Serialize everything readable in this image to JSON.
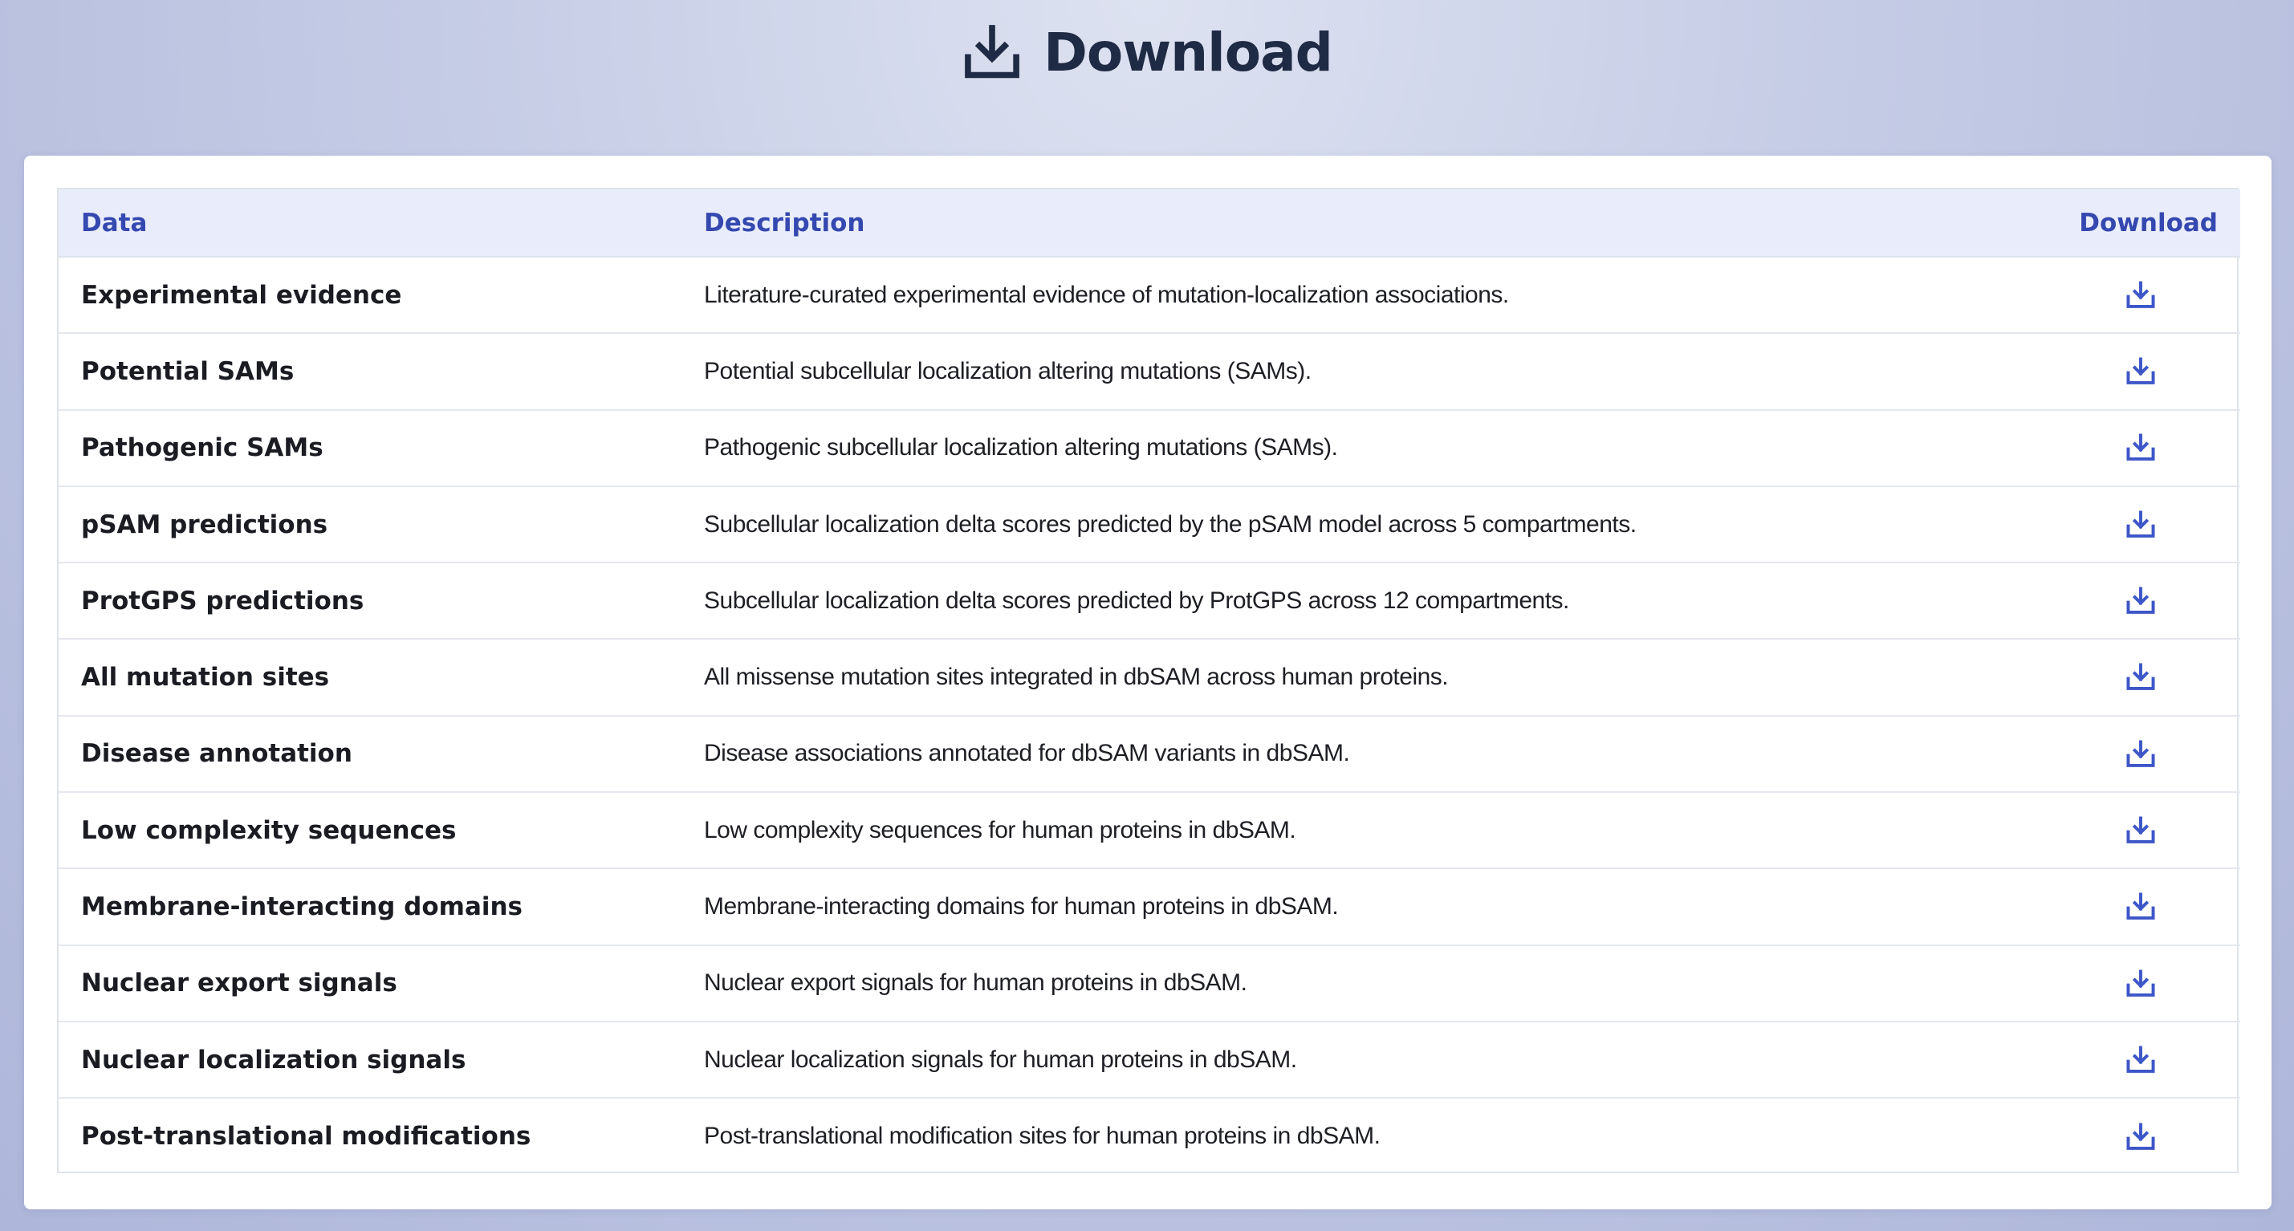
{
  "header": {
    "title": "Download",
    "icon": "download-tray-icon",
    "title_color": "#1f2a44"
  },
  "table": {
    "columns": [
      "Data",
      "Description",
      "Download"
    ],
    "header_text_color": "#3448b0",
    "header_bg": "#e9edfb",
    "download_icon": "download-icon",
    "download_icon_color": "#3d56c8",
    "rows": [
      {
        "name": "Experimental evidence",
        "description": "Literature-curated experimental evidence of mutation-localization associations."
      },
      {
        "name": "Potential SAMs",
        "description": "Potential subcellular localization altering mutations (SAMs)."
      },
      {
        "name": "Pathogenic SAMs",
        "description": "Pathogenic subcellular localization altering mutations (SAMs)."
      },
      {
        "name": "pSAM predictions",
        "description": "Subcellular localization delta scores predicted by the pSAM model across 5 compartments."
      },
      {
        "name": "ProtGPS predictions",
        "description": "Subcellular localization delta scores predicted by ProtGPS across 12 compartments."
      },
      {
        "name": "All mutation sites",
        "description": "All missense mutation sites integrated in dbSAM across human proteins."
      },
      {
        "name": "Disease annotation",
        "description": "Disease associations annotated for dbSAM variants in dbSAM."
      },
      {
        "name": "Low complexity sequences",
        "description": "Low complexity sequences for human proteins in dbSAM."
      },
      {
        "name": "Membrane-interacting domains",
        "description": "Membrane-interacting domains for human proteins in dbSAM."
      },
      {
        "name": "Nuclear export signals",
        "description": "Nuclear export signals for human proteins in dbSAM."
      },
      {
        "name": "Nuclear localization signals",
        "description": "Nuclear localization signals for human proteins in dbSAM."
      },
      {
        "name": "Post-translational modifications",
        "description": "Post-translational modification sites for human proteins in dbSAM."
      }
    ]
  }
}
